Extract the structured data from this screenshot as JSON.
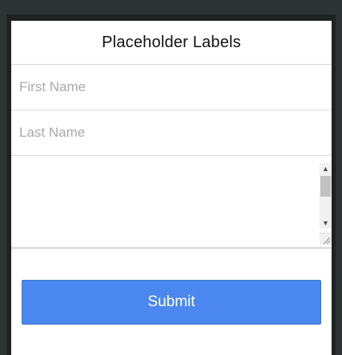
{
  "header": {
    "title": "Placeholder Labels"
  },
  "form": {
    "first_name": {
      "placeholder": "First Name",
      "value": ""
    },
    "last_name": {
      "placeholder": "Last Name",
      "value": ""
    },
    "message": {
      "value": ""
    },
    "submit_label": "Submit"
  },
  "colors": {
    "background": "#2e3333",
    "card": "#ffffff",
    "button": "#4a87ee",
    "button_text": "#ffffff",
    "placeholder": "#a9a9a9"
  }
}
